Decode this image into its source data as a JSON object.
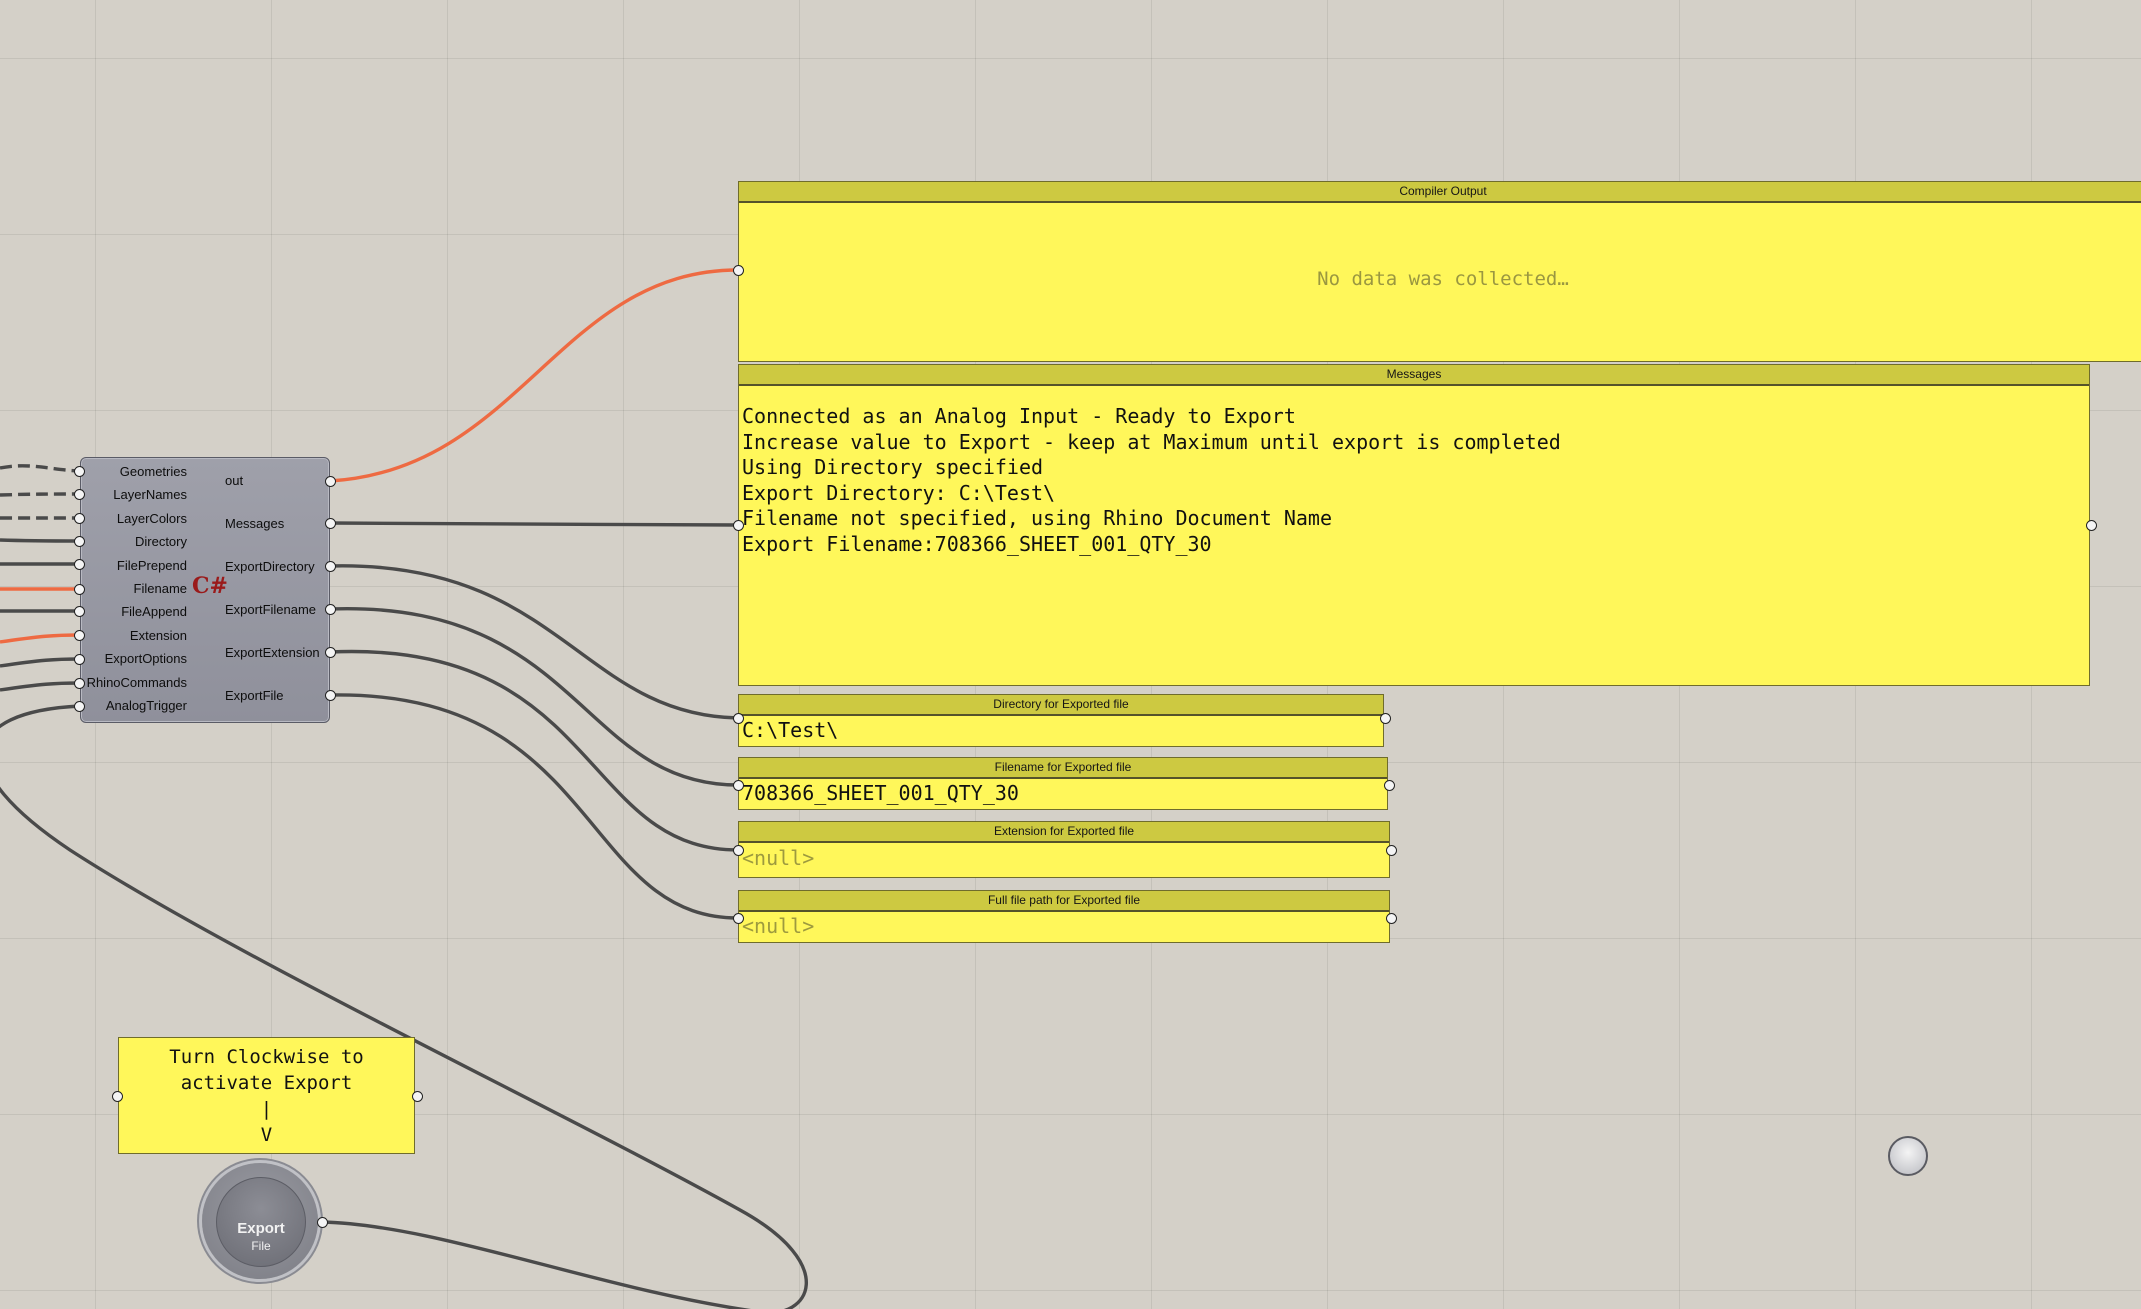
{
  "component": {
    "inputs": [
      "Geometries",
      "LayerNames",
      "LayerColors",
      "Directory",
      "FilePrepend",
      "Filename",
      "FileAppend",
      "Extension",
      "ExportOptions",
      "RhinoCommands",
      "AnalogTrigger"
    ],
    "outputs": [
      "out",
      "Messages",
      "ExportDirectory",
      "ExportFilename",
      "ExportExtension",
      "ExportFile"
    ],
    "type_icon": "C#"
  },
  "panels": {
    "compiler": {
      "title": "Compiler Output",
      "empty_text": "No data was collected…"
    },
    "messages": {
      "title": "Messages",
      "lines": [
        "Connected as an Analog Input - Ready to Export",
        "Increase value to Export - keep at Maximum until export is completed",
        "Using Directory specified",
        "Export Directory: C:\\Test\\",
        "Filename not specified, using Rhino Document Name",
        "Export Filename:708366_SHEET_001_QTY_30"
      ]
    },
    "directory": {
      "title": "Directory for Exported file",
      "value": "C:\\Test\\"
    },
    "filename": {
      "title": "Filename for Exported file",
      "value": "708366_SHEET_001_QTY_30"
    },
    "extension": {
      "title": "Extension for Exported file",
      "value": "<null>"
    },
    "fullpath": {
      "title": "Full file path for Exported file",
      "value": "<null>"
    }
  },
  "note": {
    "lines": [
      "Turn Clockwise to",
      "activate Export",
      "|",
      "V"
    ]
  },
  "dial": {
    "line1": "Export",
    "line2": "File"
  },
  "colors": {
    "canvas": "#d4d0c8",
    "panel": "#fff75a",
    "selected_wire": "#ee6a42"
  }
}
